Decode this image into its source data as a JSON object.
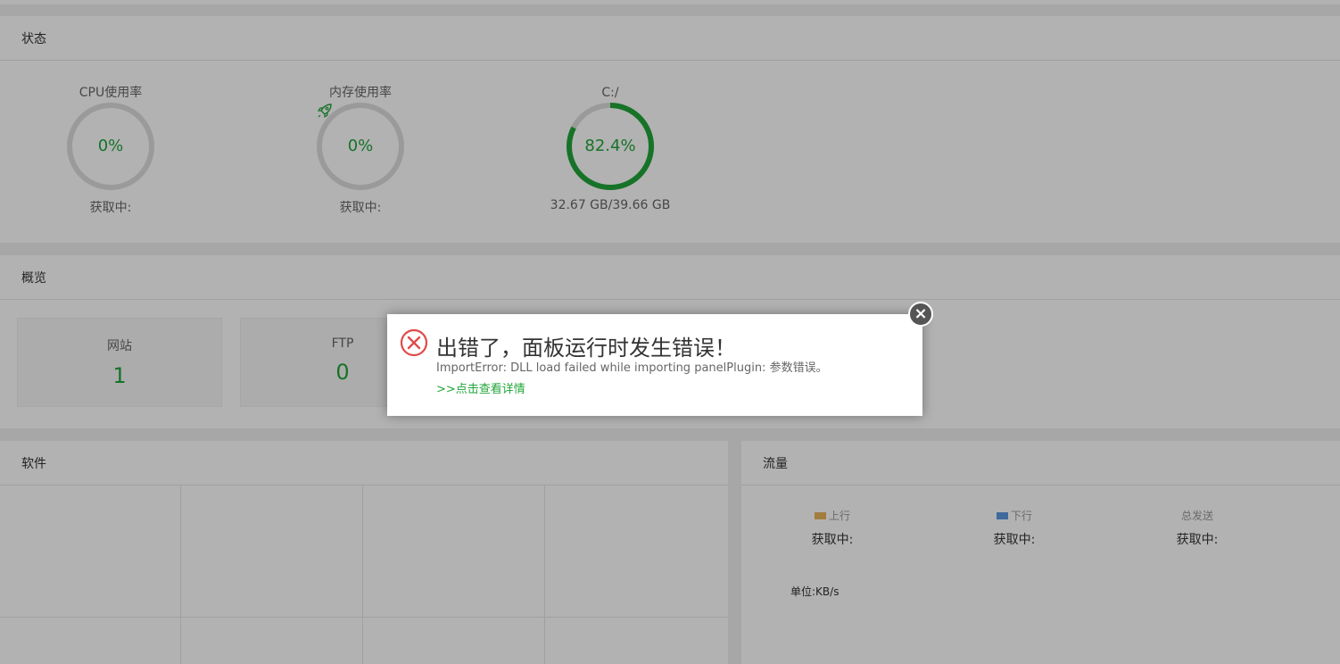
{
  "status": {
    "title": "状态",
    "gauges": [
      {
        "label": "CPU使用率",
        "value_text": "0%",
        "percent": 0,
        "sub": "获取中:",
        "icon": ""
      },
      {
        "label": "内存使用率",
        "value_text": "0%",
        "percent": 0,
        "sub": "获取中:",
        "icon": "rocket-icon"
      },
      {
        "label": "C:/",
        "value_text": "82.4%",
        "percent": 82.4,
        "sub": "32.67 GB/39.66 GB",
        "icon": ""
      }
    ]
  },
  "overview": {
    "title": "概览",
    "items": [
      {
        "label": "网站",
        "value": "1"
      },
      {
        "label": "FTP",
        "value": "0"
      }
    ]
  },
  "software": {
    "title": "软件"
  },
  "traffic": {
    "title": "流量",
    "items": [
      {
        "label": "上行",
        "value": "获取中:",
        "color": "#e8b45a"
      },
      {
        "label": "下行",
        "value": "获取中:",
        "color": "#5b9ae0"
      },
      {
        "label": "总发送",
        "value": "获取中:",
        "color": ""
      }
    ],
    "unit": "单位:KB/s"
  },
  "dialog": {
    "title": "出错了，面板运行时发生错误！",
    "message": "ImportError: DLL load failed while importing panelPlugin: 参数错误。",
    "link": ">>点击查看详情",
    "close_icon": "close-icon",
    "error_icon": "error-circle-icon"
  },
  "colors": {
    "accent": "#20a53a",
    "ring_track": "#dddddd",
    "error": "#e04b4b",
    "close_bg": "#555555"
  }
}
